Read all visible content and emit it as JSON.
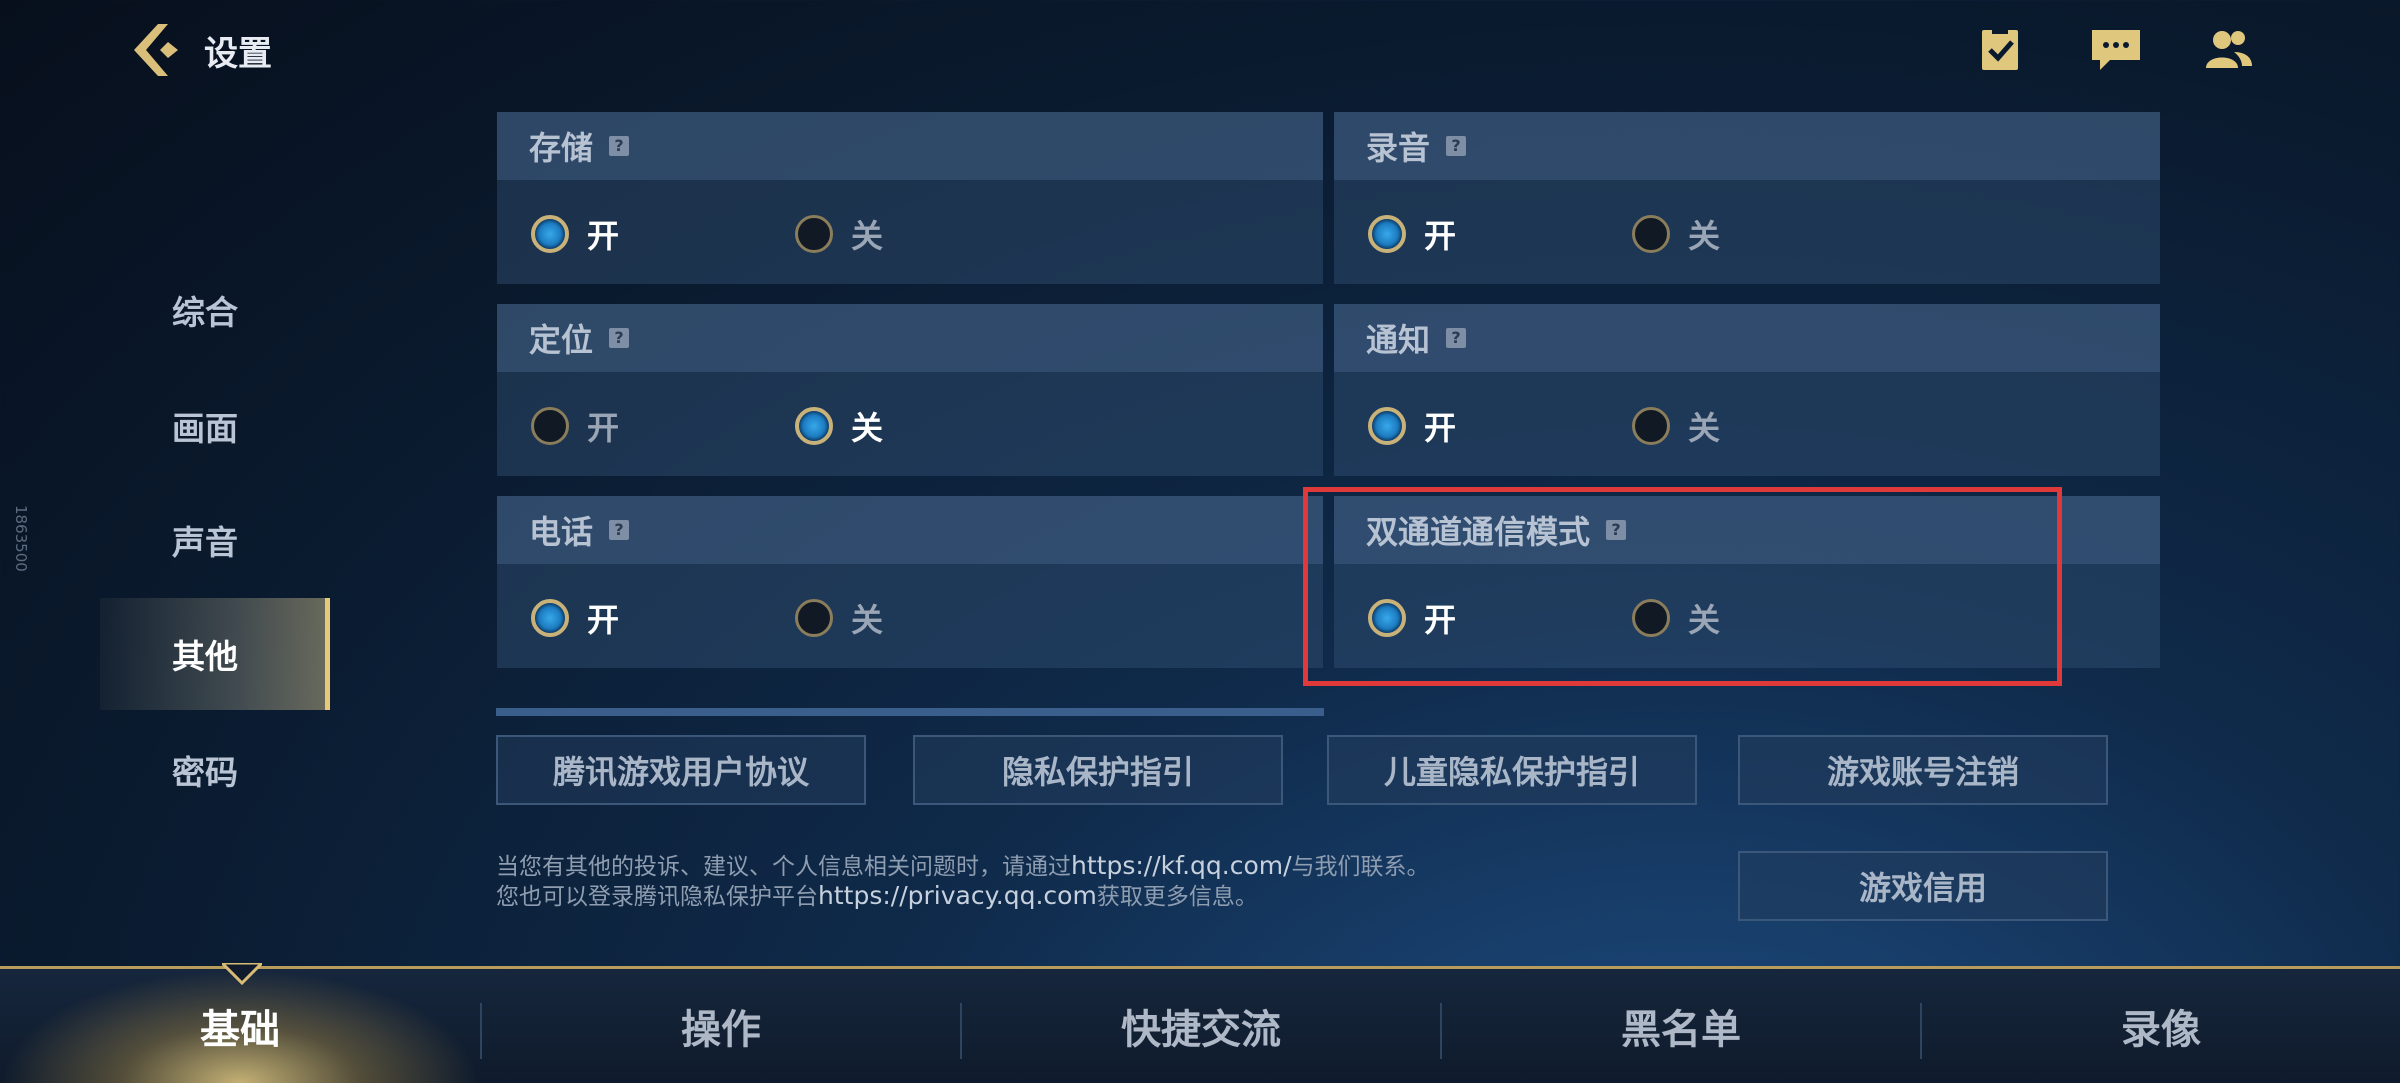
{
  "header": {
    "title": "设置",
    "icons": [
      "checklist-icon",
      "chat-icon",
      "friends-icon"
    ]
  },
  "sidebar": {
    "items": [
      {
        "label": "综合",
        "active": false
      },
      {
        "label": "画面",
        "active": false
      },
      {
        "label": "声音",
        "active": false
      },
      {
        "label": "其他",
        "active": true
      },
      {
        "label": "密码",
        "active": false
      }
    ]
  },
  "panels": [
    {
      "title": "存储",
      "on_label": "开",
      "off_label": "关",
      "selected": "on"
    },
    {
      "title": "录音",
      "on_label": "开",
      "off_label": "关",
      "selected": "on"
    },
    {
      "title": "定位",
      "on_label": "开",
      "off_label": "关",
      "selected": "off"
    },
    {
      "title": "通知",
      "on_label": "开",
      "off_label": "关",
      "selected": "on"
    },
    {
      "title": "电话",
      "on_label": "开",
      "off_label": "关",
      "selected": "on"
    },
    {
      "title": "双通道通信模式",
      "on_label": "开",
      "off_label": "关",
      "selected": "on"
    }
  ],
  "links": {
    "agreement": "腾讯游戏用户协议",
    "privacy": "隐私保护指引",
    "child_privacy": "儿童隐私保护指引",
    "account_cancel": "游戏账号注销",
    "credit": "游戏信用"
  },
  "notes": {
    "line1_prefix": "当您有其他的投诉、建议、个人信息相关问题时，请通过",
    "line1_url": "https://kf.qq.com/",
    "line1_suffix": "与我们联系。",
    "line2_prefix": "您也可以登录腾讯隐私保护平台",
    "line2_url": "https://privacy.qq.com",
    "line2_suffix": "获取更多信息。"
  },
  "side_watermark": "1863500",
  "bottom_tabs": [
    {
      "label": "基础",
      "active": true
    },
    {
      "label": "操作",
      "active": false
    },
    {
      "label": "快捷交流",
      "active": false
    },
    {
      "label": "黑名单",
      "active": false
    },
    {
      "label": "录像",
      "active": false
    }
  ],
  "colors": {
    "accent_gold": "#e7c97a",
    "radio_on": "#37a9ea",
    "highlight_red": "#e0393a"
  }
}
